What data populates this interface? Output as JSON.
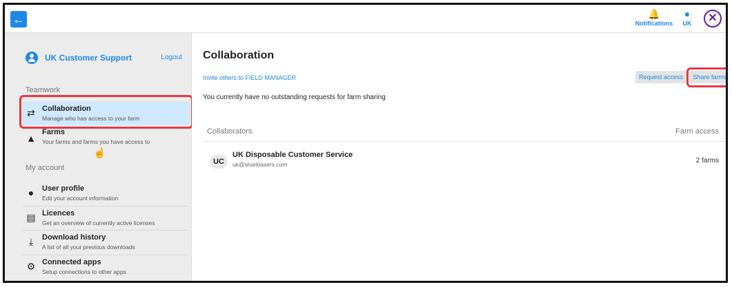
{
  "topbar": {
    "back_icon": "arrow-left-icon",
    "notifications_label": "Notifications",
    "notifications_icon": "bell-icon",
    "user_label": "UK",
    "user_icon": "person-icon",
    "close_icon": "close-circle-icon"
  },
  "sidebar": {
    "user_name": "UK Customer Support",
    "logout_label": "Logout",
    "teamwork_heading": "Teamwork",
    "teamwork_items": [
      {
        "title": "Collaboration",
        "subtitle": "Manage who has access to your farm",
        "icon": "swap-arrows-icon",
        "active": true
      },
      {
        "title": "Farms",
        "subtitle": "Your farms and farms you have access to",
        "icon": "farm-icon",
        "active": false
      }
    ],
    "account_heading": "My account",
    "account_items": [
      {
        "title": "User profile",
        "subtitle": "Edit your account information",
        "icon": "person-icon"
      },
      {
        "title": "Licences",
        "subtitle": "Get an overview of currently active licenses",
        "icon": "license-icon"
      },
      {
        "title": "Download history",
        "subtitle": "A list of all your previous downloads",
        "icon": "download-icon"
      },
      {
        "title": "Connected apps",
        "subtitle": "Setup connections to other apps",
        "icon": "gear-icon"
      }
    ]
  },
  "main": {
    "title": "Collaboration",
    "invite_link": "Invite others to FIELD MANAGER",
    "request_access_label": "Request access",
    "share_farms_label": "Share farms",
    "no_requests_text": "You currently have no outstanding requests for farm sharing",
    "collaborators_header": "Collaborators",
    "farm_access_header": "Farm access",
    "collaborators": [
      {
        "initials": "UC",
        "name": "UK Disposable Customer Service",
        "email": "uk@sharklasers.com",
        "access": "2 farms"
      }
    ]
  },
  "colors": {
    "accent": "#1e88e5",
    "highlight": "#e53945",
    "active_nav": "#cfe8fb",
    "close": "#6a1b9a"
  }
}
